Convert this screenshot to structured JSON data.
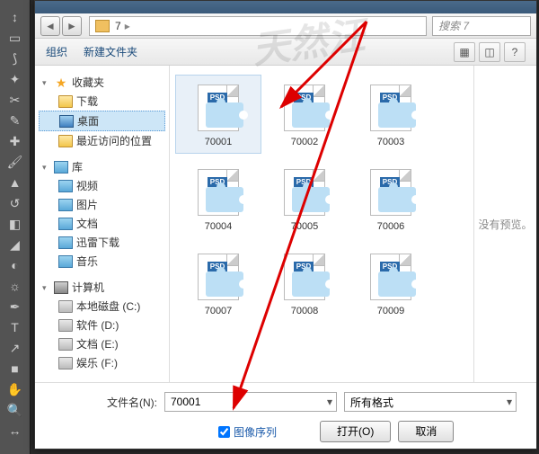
{
  "nav": {
    "folder": "7",
    "search_placeholder": "搜索 7"
  },
  "toolbar": {
    "organize": "组织",
    "new_folder": "新建文件夹"
  },
  "tree": {
    "favorites": {
      "label": "收藏夹",
      "items": [
        "下载",
        "桌面",
        "最近访问的位置"
      ],
      "selected": 1
    },
    "libraries": {
      "label": "库",
      "items": [
        "视频",
        "图片",
        "文档",
        "迅雷下载",
        "音乐"
      ]
    },
    "computer": {
      "label": "计算机",
      "items": [
        "本地磁盘 (C:)",
        "软件 (D:)",
        "文档 (E:)",
        "娱乐 (F:)"
      ]
    }
  },
  "files": {
    "items": [
      {
        "name": "70001"
      },
      {
        "name": "70002"
      },
      {
        "name": "70003"
      },
      {
        "name": "70004"
      },
      {
        "name": "70005"
      },
      {
        "name": "70006"
      },
      {
        "name": "70007"
      },
      {
        "name": "70008"
      },
      {
        "name": "70009"
      }
    ],
    "selected": 0,
    "psd_badge": "PSD"
  },
  "preview": {
    "text": "没有预览。"
  },
  "bottom": {
    "filename_label": "文件名(N):",
    "filename_value": "70001",
    "format_label": "所有格式",
    "sequence_label": "图像序列",
    "sequence_checked": true,
    "open_label": "打开(O)",
    "cancel_label": "取消"
  },
  "watermark": "天然汪"
}
